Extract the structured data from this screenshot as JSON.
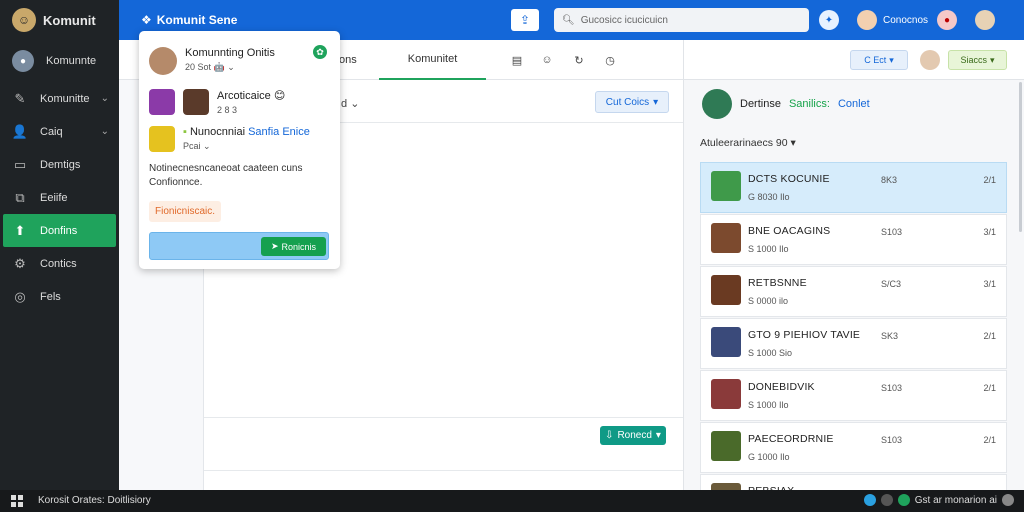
{
  "sidebar": {
    "app_name": "Komunit",
    "items": [
      {
        "label": "Komunnte",
        "icon": "user-avatar-icon"
      },
      {
        "label": "Komunitte",
        "icon": "wrench-icon"
      },
      {
        "label": "Caiq",
        "icon": "person-icon"
      },
      {
        "label": "Demtigs",
        "icon": "monitor-icon"
      },
      {
        "label": "Eeiife",
        "icon": "edit-icon"
      },
      {
        "label": "Donfins",
        "icon": "upload-icon"
      },
      {
        "label": "Contics",
        "icon": "gear-icon"
      },
      {
        "label": "Fels",
        "icon": "target-icon"
      }
    ]
  },
  "topbar": {
    "brand": "Komunit Sene",
    "search_placeholder": "Gucosicc icucicuicn",
    "user_name": "Conocnos",
    "accent": "#1467d8"
  },
  "main": {
    "tabs": [
      {
        "label": "ons"
      },
      {
        "label": "Komunitet"
      }
    ],
    "filter_label": "d",
    "sort_label": "Cut Coics",
    "send_label": "Ronecd"
  },
  "popup": {
    "row1": {
      "title": "Komunnting Onitis",
      "sub": "20 Sot",
      "emoji": "🤖"
    },
    "row2": {
      "title": "Arcoticaice",
      "sub": "2 8 3",
      "emoji": "😊"
    },
    "row3": {
      "title_a": "Nunocnniai",
      "title_b": "Sanfia Enice",
      "sub": "Pcai"
    },
    "description": "Notinecnesncaneoat caateen cuns Confionnce.",
    "tag": "Fionicniscaic.",
    "button": "Ronicnis"
  },
  "rpanel": {
    "toolbar_left": "C Ect",
    "toolbar_right": "Siaccs",
    "header_a": "Dertinse",
    "header_b": "Sanilics:",
    "header_c": "Conlet",
    "section": "Atuleerarinaecs 90",
    "items": [
      {
        "name": "DCTS KOCUNIE",
        "sub": "G 8030 Ilo",
        "num": "8K3",
        "rank": "2/1",
        "thumb": "#3f9a4a"
      },
      {
        "name": "BNE OACAGINS",
        "sub": "S 1000 Ilo",
        "num": "S103",
        "rank": "3/1",
        "thumb": "#7c4a2e"
      },
      {
        "name": "RETBSNNE",
        "sub": "S 0000 ilo",
        "num": "S/C3",
        "rank": "3/1",
        "thumb": "#6a3a22"
      },
      {
        "name": "GTO 9 PIEHIOV TAVIE",
        "sub": "S 1000 Sio",
        "num": "SK3",
        "rank": "2/1",
        "thumb": "#3a4a7a"
      },
      {
        "name": "DONEBIDVIK",
        "sub": "S 1000 Ilo",
        "num": "S103",
        "rank": "2/1",
        "thumb": "#8a3a3a"
      },
      {
        "name": "PAECEORDRNIE",
        "sub": "G 1000 Ilo",
        "num": "S103",
        "rank": "2/1",
        "thumb": "#4a6a2a"
      },
      {
        "name": "PEBSIAX",
        "sub": "",
        "num": "",
        "rank": "",
        "thumb": "#6a5a3a"
      }
    ]
  },
  "taskbar": {
    "title": "Korosit Orates: Doitlisiory",
    "tray_text": "Gst ar monarion ai"
  }
}
